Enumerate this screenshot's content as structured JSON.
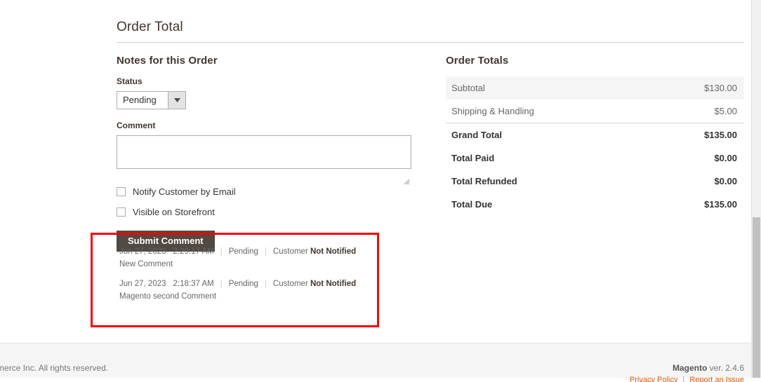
{
  "page": {
    "title": "Order Total"
  },
  "notes": {
    "section_title": "Notes for this Order",
    "status_label": "Status",
    "status_value": "Pending",
    "status_options": [
      "Pending"
    ],
    "comment_label": "Comment",
    "comment_value": "",
    "notify_label": "Notify Customer by Email",
    "notify_checked": false,
    "visible_label": "Visible on Storefront",
    "visible_checked": false,
    "submit_label": "Submit Comment"
  },
  "history": {
    "items": [
      {
        "date": "Jun 27, 2023",
        "time": "2:29:17 AM",
        "status": "Pending",
        "customer_prefix": "Customer",
        "customer_state": "Not Notified",
        "text": "New Comment"
      },
      {
        "date": "Jun 27, 2023",
        "time": "2:18:37 AM",
        "status": "Pending",
        "customer_prefix": "Customer",
        "customer_state": "Not Notified",
        "text": "Magento second Comment"
      }
    ],
    "highlight_color": "#fa0000"
  },
  "totals": {
    "section_title": "Order Totals",
    "rows": [
      {
        "label": "Subtotal",
        "amount": "$130.00",
        "style": "shaded"
      },
      {
        "label": "Shipping & Handling",
        "amount": "$5.00",
        "style": "ruled"
      },
      {
        "label": "Grand Total",
        "amount": "$135.00",
        "style": "strong"
      },
      {
        "label": "Total Paid",
        "amount": "$0.00",
        "style": "strong"
      },
      {
        "label": "Total Refunded",
        "amount": "$0.00",
        "style": "strong"
      },
      {
        "label": "Total Due",
        "amount": "$135.00",
        "style": "strong"
      }
    ]
  },
  "footer": {
    "copyright": "ento Commerce Inc. All rights reserved.",
    "brand": "Magento",
    "version": "ver. 2.4.6",
    "privacy_link": "Privacy Policy",
    "report_link": "Report an Issue"
  }
}
